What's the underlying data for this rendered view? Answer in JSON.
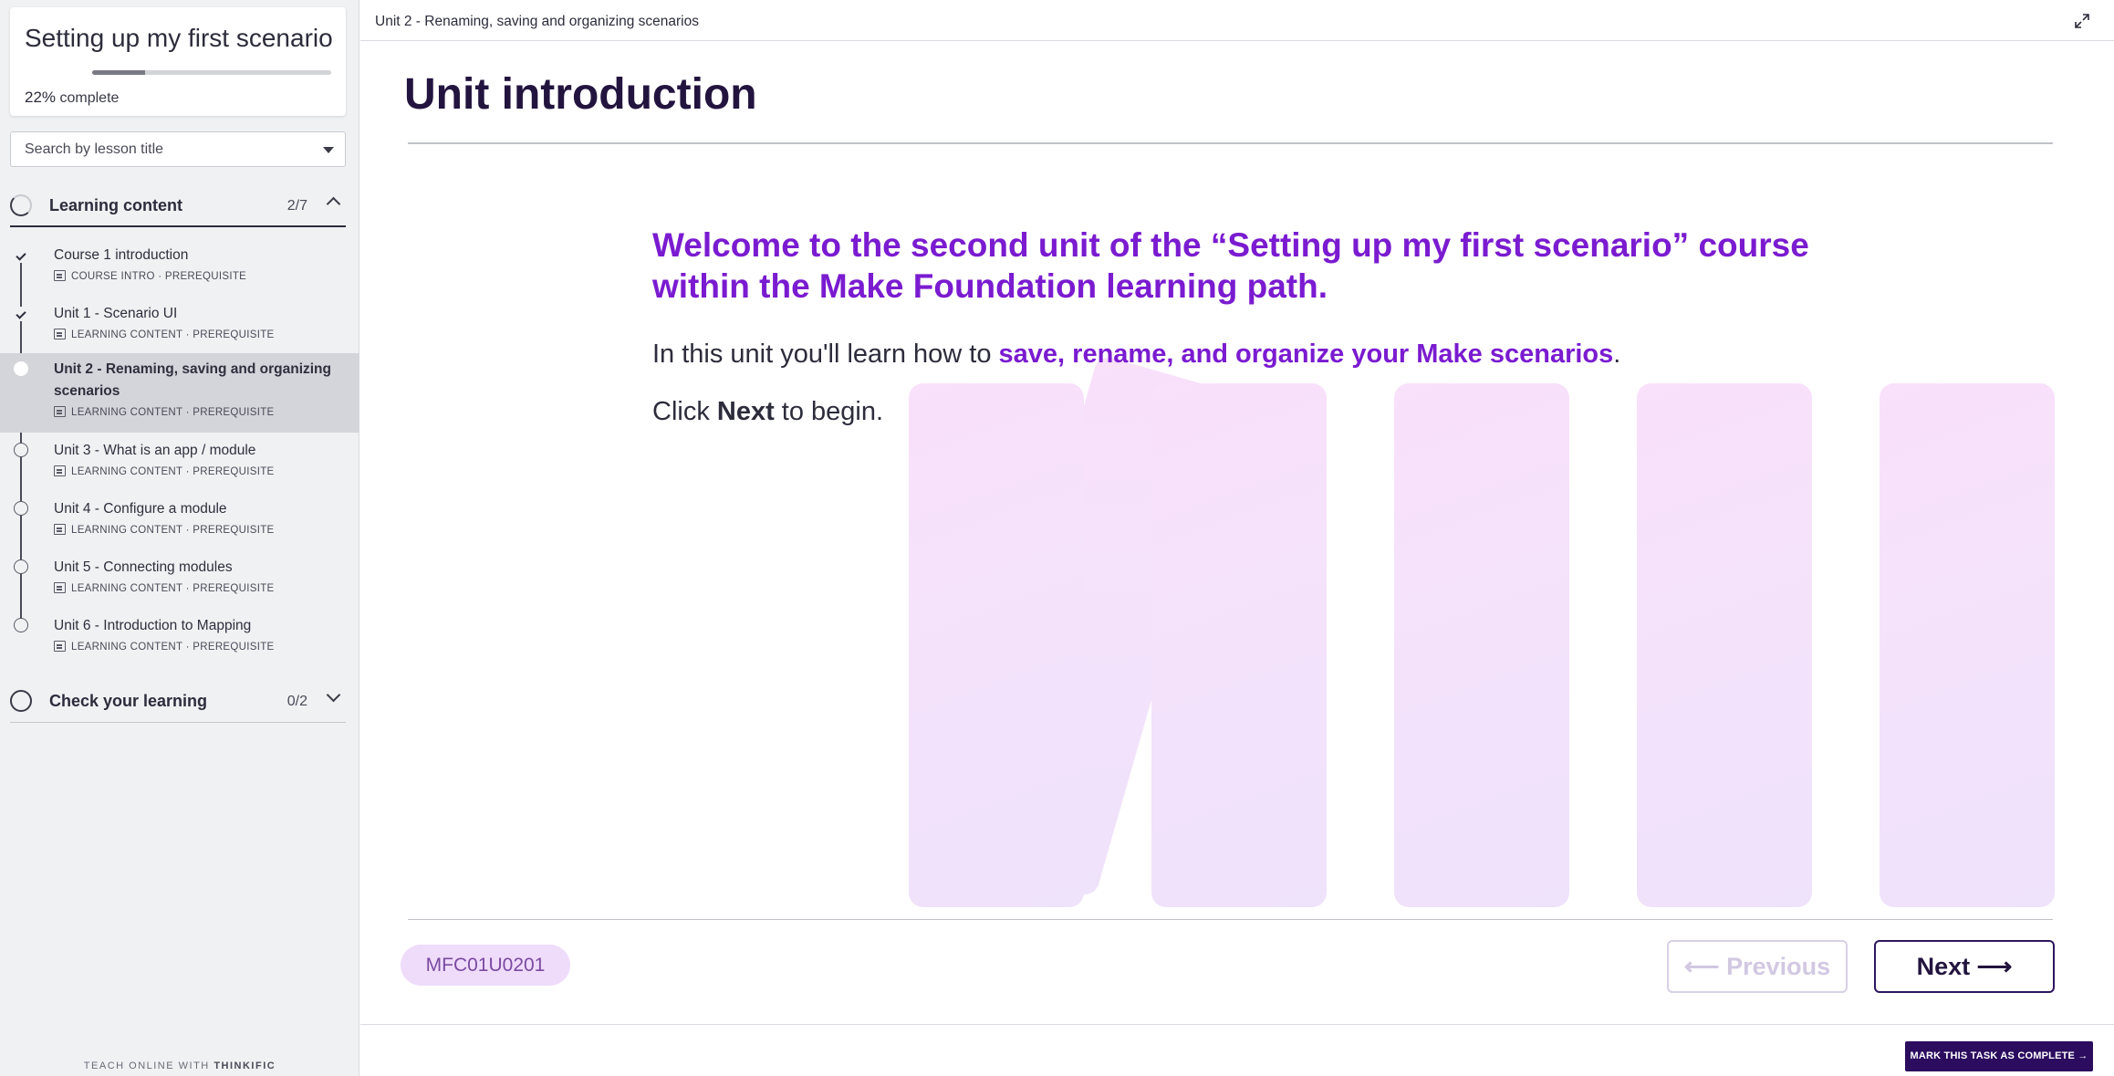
{
  "sidebar": {
    "course_title": "Setting up my first scenario",
    "progress": {
      "percent_label": "22%",
      "suffix": "complete",
      "fraction": 0.22
    },
    "search": {
      "placeholder": "Search by lesson title"
    },
    "sections": [
      {
        "title": "Learning content",
        "count": "2/7",
        "expanded": true,
        "lessons": [
          {
            "title": "Course 1 introduction",
            "meta": "COURSE INTRO · PREREQUISITE",
            "status": "complete"
          },
          {
            "title": "Unit 1 - Scenario UI",
            "meta": "LEARNING CONTENT · PREREQUISITE",
            "status": "complete"
          },
          {
            "title": "Unit 2 - Renaming, saving and organizing scenarios",
            "meta": "LEARNING CONTENT · PREREQUISITE",
            "status": "active"
          },
          {
            "title": "Unit 3 - What is an app / module",
            "meta": "LEARNING CONTENT · PREREQUISITE",
            "status": "incomplete"
          },
          {
            "title": "Unit 4 - Configure a module",
            "meta": "LEARNING CONTENT · PREREQUISITE",
            "status": "incomplete"
          },
          {
            "title": "Unit 5 - Connecting modules",
            "meta": "LEARNING CONTENT · PREREQUISITE",
            "status": "incomplete"
          },
          {
            "title": "Unit 6 - Introduction to Mapping",
            "meta": "LEARNING CONTENT · PREREQUISITE",
            "status": "incomplete"
          }
        ]
      },
      {
        "title": "Check your learning",
        "count": "0/2",
        "expanded": false
      }
    ],
    "footer": {
      "prefix": "TEACH ONLINE WITH",
      "brand": "THINKIFIC"
    }
  },
  "topbar": {
    "title": "Unit 2 - Renaming, saving and organizing scenarios",
    "expand_icon": "expand-icon"
  },
  "main": {
    "heading": "Unit introduction",
    "welcome": "Welcome to the second unit of the “Setting up my first scenario” course within the Make Foundation learning path.",
    "intro_prefix": "In this unit you'll learn how to ",
    "intro_highlight": "save, rename, and organize your Make scenarios",
    "intro_suffix": ".",
    "click_prefix": "Click ",
    "click_bold": "Next",
    "click_suffix": " to begin.",
    "code": "MFC01U0201",
    "prev_label": "Previous",
    "next_label": "Next"
  },
  "bottombar": {
    "mark_complete_label": "MARK THIS TASK AS COMPLETE"
  },
  "colors": {
    "accent": "#7a1bd0",
    "heading": "#23143f",
    "button_dark": "#2b0c5e",
    "pill_bg": "#efdcfb"
  }
}
